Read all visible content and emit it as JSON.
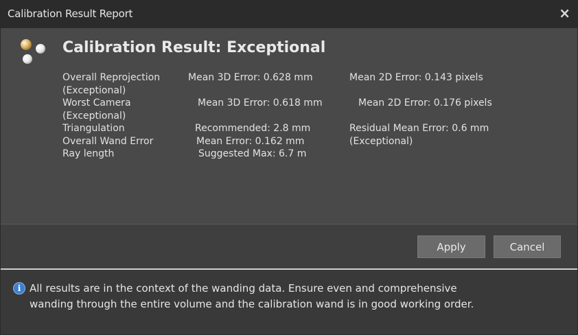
{
  "window": {
    "title": "Calibration Result Report",
    "close_glyph": "×"
  },
  "icons": {
    "logo": "three-markers-logo-icon",
    "close": "close-icon",
    "info": "info-icon"
  },
  "heading": "Calibration Result: Exceptional",
  "results": {
    "rows": [
      {
        "label": "Overall Reprojection",
        "col2": "Mean 3D Error: 0.628 mm",
        "col3": "Mean 2D Error: 0.143 pixels"
      },
      {
        "label": "(Exceptional)"
      },
      {
        "label": "Worst Camera",
        "col2": "Mean 3D Error: 0.618 mm",
        "col3": "Mean 2D Error: 0.176 pixels"
      },
      {
        "label": "(Exceptional)"
      },
      {
        "label": "Triangulation",
        "col2": "Recommended: 2.8 mm",
        "col3": "Residual Mean Error: 0.6 mm"
      },
      {
        "label": "Overall Wand Error",
        "col2": "Mean Error: 0.162 mm",
        "col3": "(Exceptional)"
      },
      {
        "label": "Ray length",
        "col2": "Suggested Max: 6.7 m"
      }
    ]
  },
  "buttons": {
    "apply": "Apply",
    "cancel": "Cancel"
  },
  "info": {
    "glyph": "i",
    "line1": "All results are in the context of the wanding data.  Ensure even and comprehensive",
    "line2": "wanding through the entire volume and the calibration wand is in good working order."
  },
  "colors": {
    "titlebar": "#2b2b2b",
    "panel": "#494949",
    "buttonbar": "#3f3f3f",
    "infobar": "#393939",
    "info_icon": "#3f7fd0",
    "text": "#e2e2e2"
  }
}
